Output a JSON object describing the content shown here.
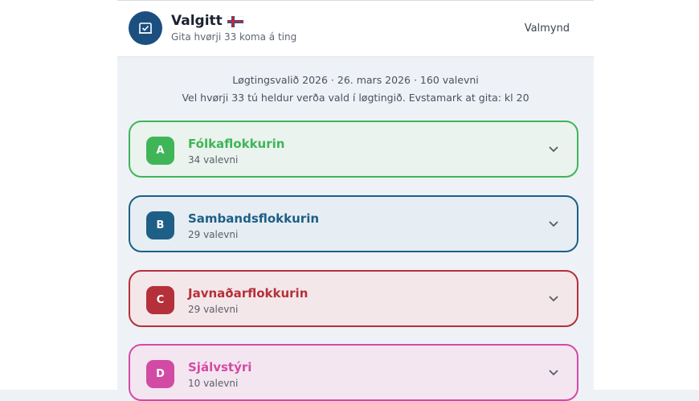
{
  "header": {
    "title": "Valgitt",
    "subtitle": "Gita hvørji 33 koma á ting",
    "menu_label": "Valmynd",
    "logo_icon": "ballot-box-icon",
    "flag_icon": "faroe-flag-icon"
  },
  "info": {
    "line1": "Løgtingsvalið 2026 · 26. mars 2026 · 160 valevni",
    "line2": "Vel hvørji 33 tú heldur verða vald í løgtingið. Evstamark at gita: kl 20"
  },
  "parties": [
    {
      "letter": "A",
      "name": "Fólkaflokkurin",
      "count": "34 valevni",
      "color": "#3fb558",
      "bg": "#eaf3ee"
    },
    {
      "letter": "B",
      "name": "Sambandsflokkurin",
      "count": "29 valevni",
      "color": "#1d5f86",
      "bg": "#e6edf3"
    },
    {
      "letter": "C",
      "name": "Javnaðarflokkurin",
      "count": "29 valevni",
      "color": "#b5303a",
      "bg": "#f4e7ea"
    },
    {
      "letter": "D",
      "name": "Sjálvstýri",
      "count": "10 valevni",
      "color": "#d34aa5",
      "bg": "#f3e6f0"
    }
  ]
}
